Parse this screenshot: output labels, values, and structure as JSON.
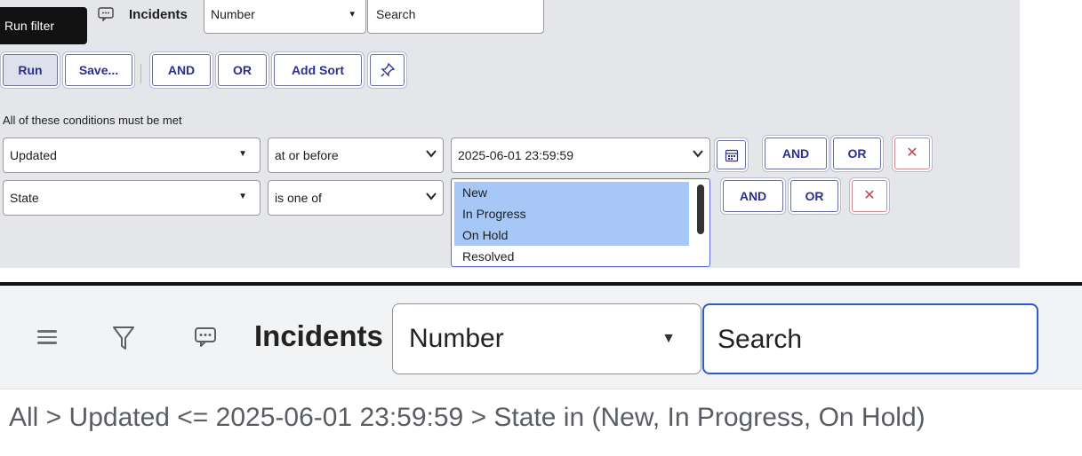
{
  "tooltip": {
    "text": "Run filter"
  },
  "header": {
    "title": "Incidents",
    "field_select": "Number",
    "search_placeholder": "Search"
  },
  "toolbar": {
    "run": "Run",
    "save": "Save...",
    "and": "AND",
    "or": "OR",
    "add_sort": "Add Sort"
  },
  "conditions_label": "All of these conditions must be met",
  "conditions": [
    {
      "field": "Updated",
      "operator": "at or before",
      "value": "2025-06-01 23:59:59",
      "and": "AND",
      "or": "OR",
      "remove": "✕"
    },
    {
      "field": "State",
      "operator": "is one of",
      "and": "AND",
      "or": "OR",
      "remove": "✕",
      "options": [
        "New",
        "In Progress",
        "On Hold",
        "Resolved"
      ],
      "selected": [
        "New",
        "In Progress",
        "On Hold"
      ]
    }
  ],
  "list_header": {
    "title": "Incidents",
    "field_select": "Number",
    "search_placeholder": "Search"
  },
  "breadcrumb": "All > Updated <= 2025-06-01 23:59:59 > State in (New, In Progress, On Hold)",
  "colors": {
    "accent": "#2b2f8f",
    "focus_border": "#2c5bd1",
    "selection": "#a7c8f6",
    "danger": "#c0474b"
  }
}
